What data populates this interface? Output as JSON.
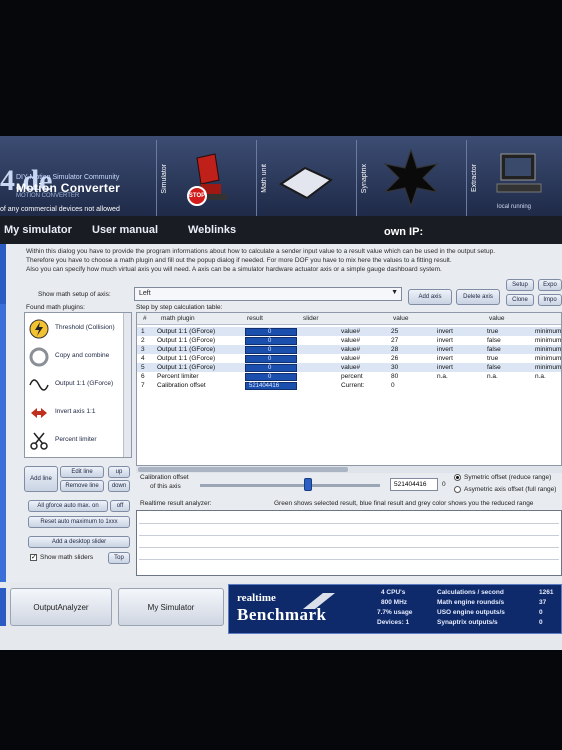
{
  "banner": {
    "logo_letters": "4.de",
    "logo_top": "DIY Motion Simulator Community",
    "logo_main": "Motion Converter",
    "logo_sub": "MOTION CONVERTER",
    "warning": "of any commercial devices not allowed",
    "modules": [
      "Simulator",
      "Math unit",
      "Synaptrix",
      "Extractor"
    ],
    "local_running": "local running",
    "stop_label": "STOP"
  },
  "menu": {
    "items": [
      "My simulator",
      "User manual",
      "Weblinks"
    ],
    "own_ip": "own IP:"
  },
  "main": {
    "instructions": [
      "Within this dialog you have to provide the program informations about how to calculate a sender input value to a result value which can be used in the output setup.",
      "Therefore you have to choose a math plugin and fill out the popup dialog if needed. For more DOF you have to mix here the values to a fitting result.",
      "Also you can specify how much virtual axis you will need. A axis can be a simulator hardware actuator axis or a simple gauge dashboard system."
    ],
    "show_math_setup_label": "Show math setup of axis:",
    "axis_selected": "Left",
    "buttons": {
      "add_axis": "Add axis",
      "delete_axis": "Delete axis",
      "setup": "Setup",
      "clone": "Clone",
      "export": "Expo",
      "import": "Impo"
    },
    "found_plugins_label": "Found math plugins:",
    "plugins": [
      {
        "label": "Threshold (Collision)",
        "icon": "lightning-icon"
      },
      {
        "label": "Copy and combine",
        "icon": "recycle-icon"
      },
      {
        "label": "Output 1:1 (GForce)",
        "icon": "sine-wave-icon"
      },
      {
        "label": "Invert axis 1:1",
        "icon": "invert-arrows-icon"
      },
      {
        "label": "Percent limiter",
        "icon": "scissors-icon"
      }
    ],
    "step_table_label": "Step by step calculation table:",
    "table_headers": [
      "#",
      "math plugin",
      "result",
      "slider",
      "value",
      "value"
    ],
    "rows": [
      {
        "n": "1",
        "plugin": "Output 1:1 (GForce)",
        "result": "0",
        "unit": "value#",
        "value": "25",
        "c1": "invert",
        "c2": "true",
        "c3": "minimum"
      },
      {
        "n": "2",
        "plugin": "Output 1:1 (GForce)",
        "result": "0",
        "unit": "value#",
        "value": "27",
        "c1": "invert",
        "c2": "false",
        "c3": "minimum"
      },
      {
        "n": "3",
        "plugin": "Output 1:1 (GForce)",
        "result": "0",
        "unit": "value#",
        "value": "28",
        "c1": "invert",
        "c2": "false",
        "c3": "minimum"
      },
      {
        "n": "4",
        "plugin": "Output 1:1 (GForce)",
        "result": "0",
        "unit": "value#",
        "value": "26",
        "c1": "invert",
        "c2": "true",
        "c3": "minimum"
      },
      {
        "n": "5",
        "plugin": "Output 1:1 (GForce)",
        "result": "0",
        "unit": "value#",
        "value": "30",
        "c1": "invert",
        "c2": "false",
        "c3": "minimum"
      },
      {
        "n": "6",
        "plugin": "Percent limiter",
        "result": "0",
        "unit": "percent",
        "value": "80",
        "c1": "n.a.",
        "c2": "n.a.",
        "c3": "n.a."
      },
      {
        "n": "7",
        "plugin": "Calibration offset",
        "result": "521404416",
        "unit": "Current:",
        "value": "0",
        "c1": "",
        "c2": "",
        "c3": ""
      }
    ],
    "left_buttons": {
      "add_line": "Add line",
      "edit_line": "Edit line",
      "remove_line": "Remove line",
      "up": "up",
      "down": "down",
      "all_gforce": "All gforce auto max. on",
      "off": "off",
      "reset_auto": "Reset auto maximum to 1xxx",
      "add_desktop_slider": "Add a desktop slider",
      "show_math_sliders": "Show math sliders",
      "top": "Top"
    },
    "calibration": {
      "label1": "Calibration offset",
      "label2": "of this axis",
      "value": "521404416",
      "suffix": "0",
      "opt1": "Symetric offset (reduce range)",
      "opt2": "Asymetric axis offset (full range)",
      "slider_position": 0.6
    },
    "analyzer_label": "Realtime result analyzer:",
    "analyzer_hint": "Green shows selected result, blue final result and grey color shows you the reduced range"
  },
  "bottom": {
    "output_analyzer": "OutputAnalyzer",
    "my_simulator": "My Simulator",
    "bench_line1": "realtime",
    "bench_line2": "Benchmark",
    "cpu": "4 CPU's",
    "mhz": "800 MHz",
    "usage": "7.7% usage",
    "devices": "Devices: 1",
    "calc_label": "Calculations / second",
    "calc_val": "1261",
    "math_label": "Math engine rounds/s",
    "math_val": "37",
    "uso_label": "USO engine outputs/s",
    "uso_val": "0",
    "syn_label": "Synaptrix outputs/s",
    "syn_val": "0"
  }
}
